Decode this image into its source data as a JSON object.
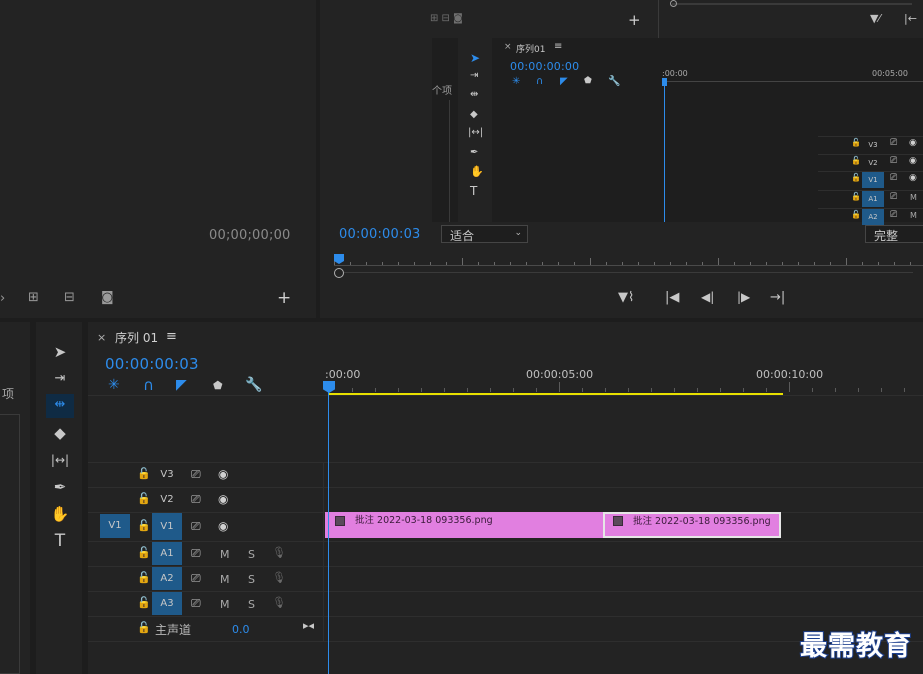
{
  "source_monitor": {
    "timecode": "00;00;00;00"
  },
  "program_monitor": {
    "timecode": "00:00:00:03",
    "fit_label": "适合",
    "quality_label": "完整",
    "mini_sequence": {
      "tab": "序列01",
      "timecode": "00:00:00:00",
      "ruler": [
        ":00:00",
        "00:05:00"
      ],
      "tracks": [
        "V3",
        "V2",
        "V1",
        "A1",
        "A2"
      ],
      "side_label": "个项"
    }
  },
  "left_panel": {
    "label": "项"
  },
  "timeline": {
    "tab_close": "×",
    "tab_label": "序列 01",
    "tab_menu": "≡",
    "timecode": "00:00:00:03",
    "ruler": [
      ":00:00",
      "00:00:05:00",
      "00:00:10:00"
    ],
    "video_tracks": [
      {
        "name": "V3",
        "source": ""
      },
      {
        "name": "V2",
        "source": ""
      },
      {
        "name": "V1",
        "source": "V1"
      }
    ],
    "audio_tracks": [
      {
        "name": "A1",
        "m": "M",
        "s": "S"
      },
      {
        "name": "A2",
        "m": "M",
        "s": "S"
      },
      {
        "name": "A3",
        "m": "M",
        "s": "S"
      }
    ],
    "master": {
      "label": "主声道",
      "value": "0.0"
    },
    "clips": [
      {
        "label": "批注 2022-03-18 093356.png"
      },
      {
        "label": "批注 2022-03-18 093356.png"
      }
    ]
  },
  "watermark": "最需教育",
  "colors": {
    "accent": "#2d8ceb",
    "clip": "#e17fe0",
    "work_area": "#e8e000",
    "track_selected": "#1f5a8a"
  },
  "icons": [
    "selection-tool-icon",
    "track-select-tool-icon",
    "ripple-edit-tool-icon",
    "razor-tool-icon",
    "slip-tool-icon",
    "pen-tool-icon",
    "hand-tool-icon",
    "type-tool-icon",
    "lock-icon",
    "toggle-output-icon",
    "eye-icon",
    "mic-icon",
    "wrench-icon",
    "magnet-icon",
    "marker-icon"
  ]
}
